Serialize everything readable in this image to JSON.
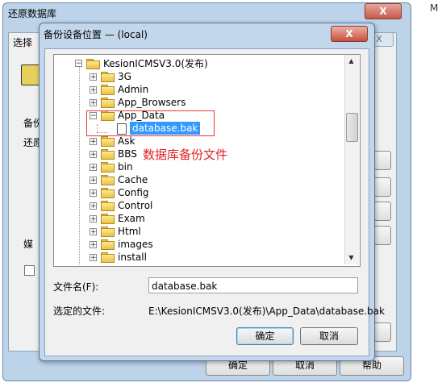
{
  "background_window": {
    "title": "还原数据库",
    "close_label": "X",
    "inner_title": "选择",
    "inner_close_label": "X",
    "right_text": "M",
    "labels": {
      "backup": "备份",
      "restore": "还原",
      "media": "媒"
    },
    "footer_buttons": [
      "确定",
      "取消",
      "帮助"
    ]
  },
  "dialog": {
    "title": "备份设备位置 — (local)",
    "close_label": "X",
    "tree": {
      "root": "KesionICMSV3.0(发布)",
      "items": [
        "3G",
        "Admin",
        "App_Browsers",
        "App_Data",
        "database.bak",
        "Ask",
        "BBS",
        "bin",
        "Cache",
        "Config",
        "Control",
        "Exam",
        "Html",
        "images",
        "install"
      ]
    },
    "annotation": "数据库备份文件",
    "filename_label": "文件名(F):",
    "filename_value": "database.bak",
    "selected_label": "选定的文件:",
    "selected_value": "E:\\KesionICMSV3.0(发布)\\App_Data\\database.bak",
    "ok_label": "确定",
    "cancel_label": "取消"
  },
  "colors": {
    "annotation": "#e02020",
    "selection": "#3399ff"
  }
}
